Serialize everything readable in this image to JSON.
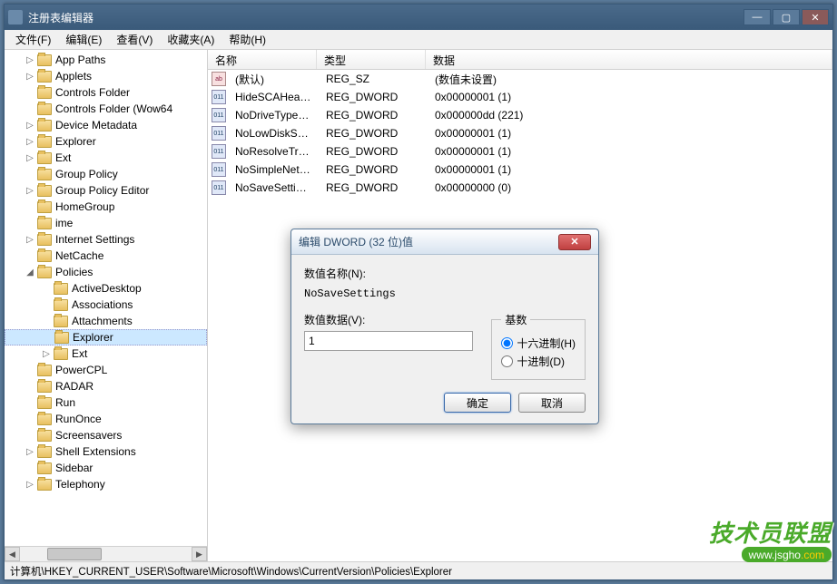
{
  "window": {
    "title": "注册表编辑器"
  },
  "menu": [
    "文件(F)",
    "编辑(E)",
    "查看(V)",
    "收藏夹(A)",
    "帮助(H)"
  ],
  "winbtns": {
    "min": "—",
    "max": "▢",
    "close": "✕"
  },
  "tree": {
    "items": [
      {
        "indent": 1,
        "exp": "▷",
        "label": "App Paths"
      },
      {
        "indent": 1,
        "exp": "▷",
        "label": "Applets"
      },
      {
        "indent": 1,
        "exp": "",
        "label": "Controls Folder"
      },
      {
        "indent": 1,
        "exp": "",
        "label": "Controls Folder (Wow64"
      },
      {
        "indent": 1,
        "exp": "▷",
        "label": "Device Metadata"
      },
      {
        "indent": 1,
        "exp": "▷",
        "label": "Explorer"
      },
      {
        "indent": 1,
        "exp": "▷",
        "label": "Ext"
      },
      {
        "indent": 1,
        "exp": "",
        "label": "Group Policy"
      },
      {
        "indent": 1,
        "exp": "▷",
        "label": "Group Policy Editor"
      },
      {
        "indent": 1,
        "exp": "",
        "label": "HomeGroup"
      },
      {
        "indent": 1,
        "exp": "",
        "label": "ime"
      },
      {
        "indent": 1,
        "exp": "▷",
        "label": "Internet Settings"
      },
      {
        "indent": 1,
        "exp": "",
        "label": "NetCache"
      },
      {
        "indent": 1,
        "exp": "◢",
        "label": "Policies"
      },
      {
        "indent": 2,
        "exp": "",
        "label": "ActiveDesktop"
      },
      {
        "indent": 2,
        "exp": "",
        "label": "Associations"
      },
      {
        "indent": 2,
        "exp": "",
        "label": "Attachments"
      },
      {
        "indent": 2,
        "exp": "",
        "label": "Explorer",
        "selected": true
      },
      {
        "indent": 2,
        "exp": "▷",
        "label": "Ext"
      },
      {
        "indent": 1,
        "exp": "",
        "label": "PowerCPL"
      },
      {
        "indent": 1,
        "exp": "",
        "label": "RADAR"
      },
      {
        "indent": 1,
        "exp": "",
        "label": "Run"
      },
      {
        "indent": 1,
        "exp": "",
        "label": "RunOnce"
      },
      {
        "indent": 1,
        "exp": "",
        "label": "Screensavers"
      },
      {
        "indent": 1,
        "exp": "▷",
        "label": "Shell Extensions"
      },
      {
        "indent": 1,
        "exp": "",
        "label": "Sidebar"
      },
      {
        "indent": 1,
        "exp": "▷",
        "label": "Telephony"
      }
    ]
  },
  "list": {
    "columns": {
      "name": "名称",
      "type": "类型",
      "data": "数据"
    },
    "widths": {
      "name": 120,
      "type": 120,
      "data": 300
    },
    "rows": [
      {
        "icon": "sz",
        "name": "(默认)",
        "type": "REG_SZ",
        "data": "(数值未设置)"
      },
      {
        "icon": "dw",
        "name": "HideSCAHealth",
        "type": "REG_DWORD",
        "data": "0x00000001 (1)"
      },
      {
        "icon": "dw",
        "name": "NoDriveTypeA...",
        "type": "REG_DWORD",
        "data": "0x000000dd (221)"
      },
      {
        "icon": "dw",
        "name": "NoLowDiskSp...",
        "type": "REG_DWORD",
        "data": "0x00000001 (1)"
      },
      {
        "icon": "dw",
        "name": "NoResolveTrack",
        "type": "REG_DWORD",
        "data": "0x00000001 (1)"
      },
      {
        "icon": "dw",
        "name": "NoSimpleNetI...",
        "type": "REG_DWORD",
        "data": "0x00000001 (1)"
      },
      {
        "icon": "dw",
        "name": "NoSaveSettings",
        "type": "REG_DWORD",
        "data": "0x00000000 (0)"
      }
    ]
  },
  "status": "计算机\\HKEY_CURRENT_USER\\Software\\Microsoft\\Windows\\CurrentVersion\\Policies\\Explorer",
  "dialog": {
    "title": "编辑 DWORD (32 位)值",
    "name_label": "数值名称(N):",
    "name_value": "NoSaveSettings",
    "data_label": "数值数据(V):",
    "data_value": "1",
    "base_label": "基数",
    "hex_label": "十六进制(H)",
    "dec_label": "十进制(D)",
    "ok": "确定",
    "cancel": "取消",
    "close_x": "✕"
  },
  "watermark": {
    "line1": "技术员联盟",
    "line2a": "www.jsgho",
    "line2b": ".com"
  }
}
